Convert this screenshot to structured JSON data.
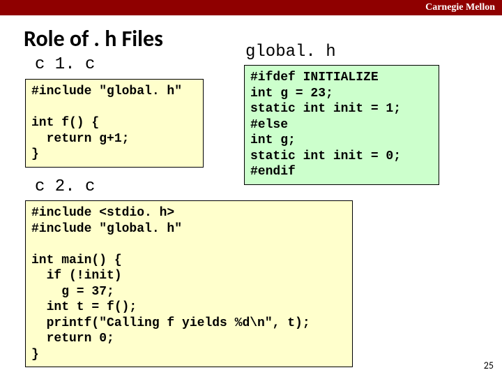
{
  "header": {
    "institution": "Carnegie Mellon"
  },
  "title": "Role of . h Files",
  "labels": {
    "c1": "c 1. c",
    "c2": "c 2. c",
    "globalh": "global. h"
  },
  "code": {
    "c1": "#include \"global. h\"\n\nint f() {\n  return g+1;\n}",
    "globalh": "#ifdef INITIALIZE\nint g = 23;\nstatic int init = 1;\n#else\nint g;\nstatic int init = 0;\n#endif",
    "c2": "#include <stdio. h>\n#include \"global. h\"\n\nint main() {\n  if (!init)\n    g = 37;\n  int t = f();\n  printf(\"Calling f yields %d\\n\", t);\n  return 0;\n}"
  },
  "page_number": "25"
}
